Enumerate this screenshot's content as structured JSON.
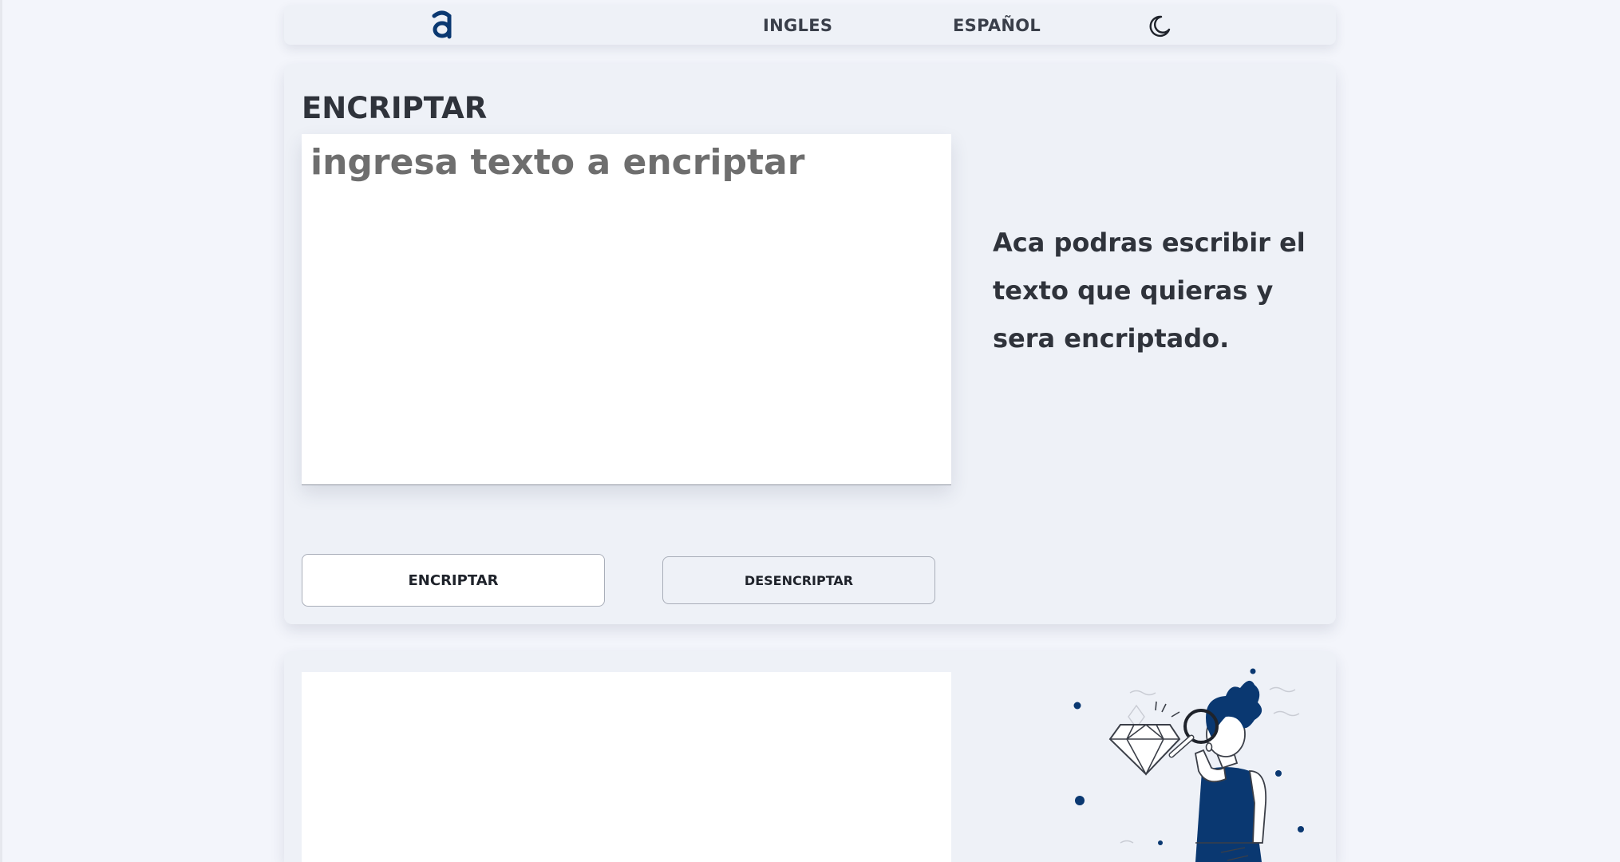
{
  "header": {
    "logo_alt": "a",
    "nav": {
      "english_label": "INGLES",
      "spanish_label": "ESPAÑOL"
    },
    "theme_icon": "moon-icon"
  },
  "encrypt_card": {
    "title": "ENCRIPTAR",
    "input": {
      "value": "",
      "placeholder": "ingresa texto a encriptar"
    },
    "info_text": "Aca podras escribir el texto que quieras y sera encriptado.",
    "encrypt_button_label": "ENCRIPTAR",
    "decrypt_button_label": "DESENCRIPTAR"
  },
  "result_card": {
    "output_value": "",
    "illustration": "person-with-magnifier-illustration"
  },
  "colors": {
    "background": "#f3f5fb",
    "card": "#eef1f7",
    "brand_blue": "#0a3871",
    "text_dark": "#2f333b"
  }
}
